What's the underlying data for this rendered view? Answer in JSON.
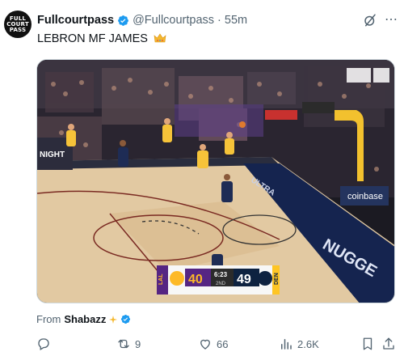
{
  "post": {
    "avatar_text": [
      "FULL",
      "COURT",
      "PASS"
    ],
    "display_name": "Fullcourtpass",
    "handle": "@Fullcourtpass",
    "separator": "·",
    "time": "55m",
    "text": "LEBRON MF JAMES",
    "more_icon": "⋯"
  },
  "media": {
    "scoreboard": {
      "away_team": "LAL",
      "away_score": "40",
      "clock": "6:23",
      "period": "2ND",
      "home_score": "49",
      "home_team": "DEN"
    },
    "court_text": {
      "sponsor_left": "NIGHT",
      "baseline": "ULTRA",
      "sign": "coinbase",
      "floor": "NUGGE"
    }
  },
  "attribution": {
    "prefix": "From",
    "source": "Shabazz"
  },
  "actions": {
    "reply_count": "",
    "repost_count": "9",
    "like_count": "66",
    "views_count": "2.6K"
  },
  "colors": {
    "verified": "#1d9bf0",
    "lakers_purple": "#552583",
    "lakers_gold": "#fdb927",
    "nuggets_navy": "#0e2240"
  },
  "icons": [
    "verified-badge-icon",
    "grok-icon",
    "more-icon",
    "crown-emoji-icon",
    "reply-icon",
    "repost-icon",
    "like-icon",
    "views-icon",
    "bookmark-icon",
    "share-icon"
  ]
}
